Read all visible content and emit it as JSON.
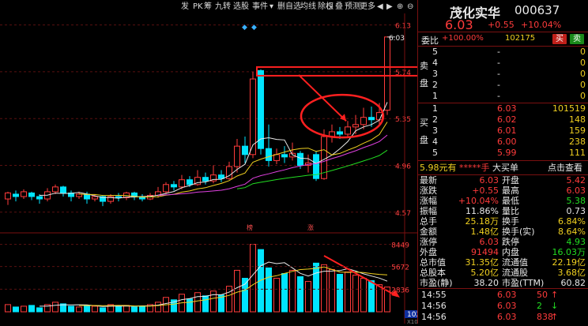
{
  "toolbar": {
    "items": [
      "发",
      "PK",
      "筹",
      "九转",
      "选股",
      "事件",
      "▾",
      "删自选",
      "均线",
      "除权",
      "叠",
      "预测",
      "更多"
    ]
  },
  "chart": {
    "price_ticks": [
      "6.13",
      "5.74",
      "5.35",
      "4.96",
      "4.57"
    ],
    "current_price_label": "6.03",
    "volume_ticks": [
      "8449",
      "5672",
      "2836"
    ],
    "volume_cursor_value": "1022",
    "volume_unit": "X100",
    "event_markers": [
      "榜",
      "涨"
    ],
    "colors": {
      "up": "#ff3b3b",
      "down": "#00e5ff",
      "ma5": "#e8e8e8",
      "ma10": "#f0d020",
      "ma20": "#e040e0",
      "ma30": "#22dd22",
      "ma60": "#2080ff",
      "annotation": "#ff2020"
    }
  },
  "stock": {
    "name": "茂化实华",
    "code": "000637",
    "price": "6.03",
    "change": "+0.55",
    "change_pct": "+10.04%"
  },
  "weibi": {
    "label": "委比",
    "ratio": "+100.00%",
    "diff": "102175",
    "btn_buy": "买",
    "btn_sell": "卖"
  },
  "sell_book": {
    "side_label": "卖盘",
    "levels": [
      {
        "n": "5",
        "price": "-",
        "vol": "0"
      },
      {
        "n": "4",
        "price": "-",
        "vol": "0"
      },
      {
        "n": "3",
        "price": "-",
        "vol": "0"
      },
      {
        "n": "2",
        "price": "-",
        "vol": "0"
      },
      {
        "n": "1",
        "price": "-",
        "vol": "0"
      }
    ]
  },
  "buy_book": {
    "side_label": "买盘",
    "levels": [
      {
        "n": "1",
        "price": "6.03",
        "vol": "101519"
      },
      {
        "n": "2",
        "price": "6.02",
        "vol": "148"
      },
      {
        "n": "3",
        "price": "6.01",
        "vol": "159"
      },
      {
        "n": "4",
        "price": "6.00",
        "vol": "238"
      },
      {
        "n": "5",
        "price": "5.99",
        "vol": "111"
      }
    ]
  },
  "bigorder": {
    "left": "5.98元有",
    "stars": "*****手",
    "mid": "大买单",
    "right": "点击查看"
  },
  "quote_rows": [
    {
      "l1": "最新",
      "v1": "6.03",
      "c1": "red",
      "l2": "开盘",
      "v2": "5.42",
      "c2": "red"
    },
    {
      "l1": "涨跌",
      "v1": "+0.55",
      "c1": "red",
      "l2": "最高",
      "v2": "6.03",
      "c2": "red"
    },
    {
      "l1": "涨幅",
      "v1": "+10.04%",
      "c1": "red",
      "l2": "最低",
      "v2": "5.38",
      "c2": "green"
    },
    {
      "l1": "振幅",
      "v1": "11.86%",
      "c1": "white",
      "l2": "量比",
      "v2": "0.73",
      "c2": "white"
    },
    {
      "l1": "总手",
      "v1": "25.18万",
      "c1": "yellow",
      "l2": "换手",
      "v2": "6.84%",
      "c2": "yellow"
    },
    {
      "l1": "金额",
      "v1": "1.48亿",
      "c1": "yellow",
      "l2": "换手(实)",
      "v2": "8.64%",
      "c2": "yellow"
    },
    {
      "l1": "涨停",
      "v1": "6.03",
      "c1": "red",
      "l2": "跌停",
      "v2": "4.93",
      "c2": "green"
    },
    {
      "l1": "外盘",
      "v1": "91494",
      "c1": "red",
      "l2": "内盘",
      "v2": "16.03万",
      "c2": "green"
    },
    {
      "l1": "总市值",
      "v1": "31.35亿",
      "c1": "yellow",
      "l2": "流通值",
      "v2": "22.19亿",
      "c2": "yellow"
    },
    {
      "l1": "总股本",
      "v1": "5.20亿",
      "c1": "yellow",
      "l2": "流通股",
      "v2": "3.68亿",
      "c2": "yellow"
    },
    {
      "l1": "市盈(静)",
      "v1": "38.20",
      "c1": "white",
      "l2": "市盈(TTM)",
      "v2": "60.82",
      "c2": "white"
    }
  ],
  "ticks": [
    {
      "time": "14:55",
      "price": "6.03",
      "vol": "50",
      "arrow": "up"
    },
    {
      "time": "14:56",
      "price": "6.03",
      "vol": "2",
      "arrow": "down"
    },
    {
      "time": "14:56",
      "price": "6.03",
      "vol": "838",
      "arrow": "up"
    }
  ]
}
